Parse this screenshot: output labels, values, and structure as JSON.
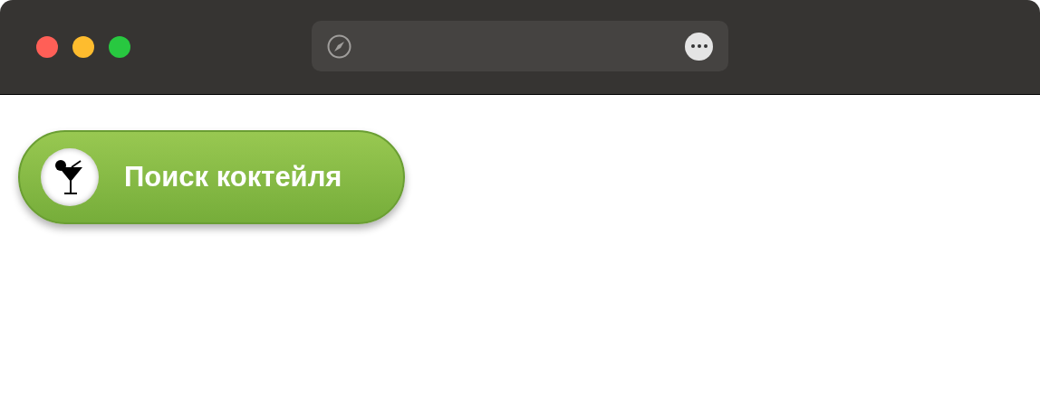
{
  "browser": {
    "window_controls": [
      {
        "color": "#ff5f57"
      },
      {
        "color": "#febc2e"
      },
      {
        "color": "#28c840"
      }
    ]
  },
  "button": {
    "label": "Поиск коктейля"
  }
}
